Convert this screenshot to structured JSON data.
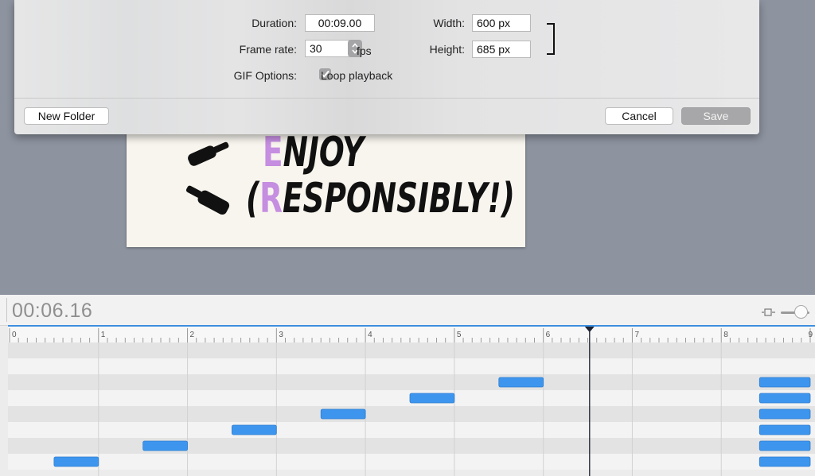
{
  "dialog": {
    "duration_label": "Duration:",
    "duration_value": "00:09.00",
    "frame_rate_label": "Frame rate:",
    "frame_rate_value": "30",
    "fps_label": "fps",
    "gif_options_label": "GIF Options:",
    "loop_playback_label": "Loop playback",
    "loop_playback_checked": true,
    "width_label": "Width:",
    "width_value": "600 px",
    "height_label": "Height:",
    "height_value": "685 px",
    "new_folder_label": "New Folder",
    "cancel_label": "Cancel",
    "save_label": "Save"
  },
  "artwork": {
    "line1_highlight": "E",
    "line1_rest": "NJOY",
    "line2_open": "(",
    "line2_highlight": "R",
    "line2_rest": "ESPONSIBLY!)",
    "highlight_color": "#c58ee0"
  },
  "timeline": {
    "timecode": "00:06.16",
    "duration_seconds": 9,
    "playhead_seconds": 6.52,
    "ruler_labels": [
      "0",
      "1",
      "2",
      "3",
      "4",
      "5",
      "6",
      "7",
      "8",
      "9"
    ],
    "rows": 8,
    "keyframes": [
      {
        "row": 2,
        "start": 5.5,
        "end": 6.0
      },
      {
        "row": 3,
        "start": 4.5,
        "end": 5.0
      },
      {
        "row": 4,
        "start": 3.5,
        "end": 4.0
      },
      {
        "row": 5,
        "start": 2.5,
        "end": 3.0
      },
      {
        "row": 6,
        "start": 1.5,
        "end": 2.0
      },
      {
        "row": 7,
        "start": 0.5,
        "end": 1.0
      },
      {
        "row": 2,
        "start": 8.43,
        "end": 9.0
      },
      {
        "row": 3,
        "start": 8.43,
        "end": 9.0
      },
      {
        "row": 4,
        "start": 8.43,
        "end": 9.0
      },
      {
        "row": 5,
        "start": 8.43,
        "end": 9.0
      },
      {
        "row": 6,
        "start": 8.43,
        "end": 9.0
      },
      {
        "row": 7,
        "start": 8.43,
        "end": 9.0
      }
    ],
    "keyframe_color": "#3d95ee",
    "accent_color": "#3d8fe0"
  }
}
